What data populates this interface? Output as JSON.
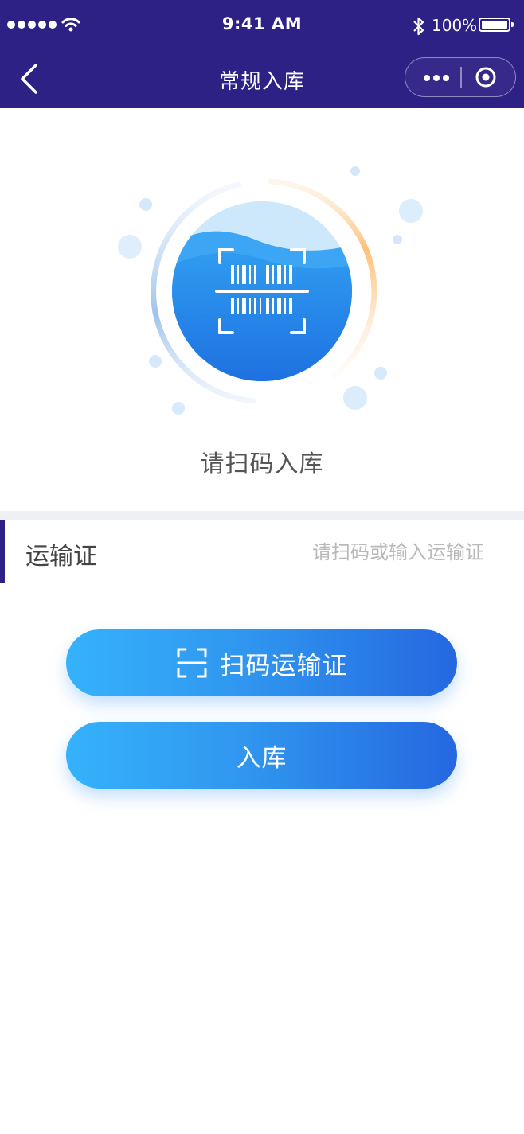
{
  "status_bar": {
    "time": "9:41 AM",
    "battery": "100%"
  },
  "nav": {
    "title": "常规入库",
    "back_icon": "chevron-left-icon",
    "more_icon": "more-dots-icon",
    "close_icon": "target-circle-icon"
  },
  "hero": {
    "icon": "barcode-scan-icon",
    "caption": "请扫码入库"
  },
  "form": {
    "transport_label": "运输证",
    "transport_placeholder": "请扫码或输入运输证",
    "transport_value": ""
  },
  "buttons": {
    "scan_label": "扫码运输证",
    "scan_icon": "scan-frame-icon",
    "stock_label": "入库"
  },
  "colors": {
    "header_bg": "#2e2185",
    "button_gradient_start": "#35b2fb",
    "button_gradient_end": "#2567e0",
    "accent_bar": "#2e2185"
  }
}
